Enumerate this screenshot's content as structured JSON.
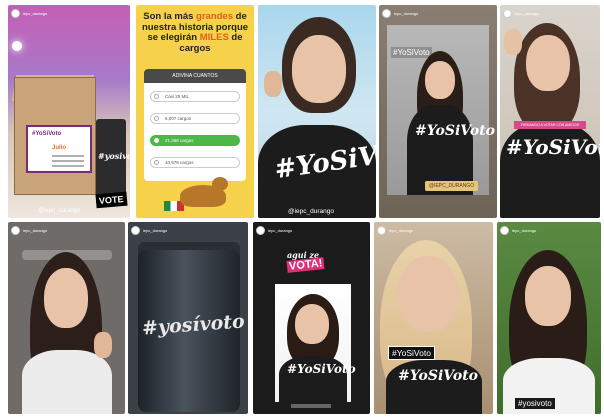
{
  "story1": {
    "username": "iepc_durango",
    "card_title": "#YoSiVoto",
    "card_name": "Julio",
    "tumbler_text": "#yosivoto",
    "vote_sticker": "VOTE",
    "bottom_tag": "@iepc_durango"
  },
  "story2": {
    "title_part1": "Son la más ",
    "title_hl1": "grandes",
    "title_part2": " de nuestra historia porque se elegirán ",
    "title_hl2": "MILES",
    "title_part3": " de cargos",
    "quiz_header": "ADIVINA CUANTOS",
    "options": [
      "Casi 25 MIL",
      "6,007 cargos",
      "21,368 cargos",
      "10,578 cargos"
    ]
  },
  "story3": {
    "shirt_text": "#YoSiVoto",
    "bottom_tag": "@iepc_durango"
  },
  "story4": {
    "username": "iepc_durango",
    "hashtag": "#YoSiVoto",
    "shirt_text": "#YoSiVoto",
    "pill": "@IEPC_DURANGO"
  },
  "story5": {
    "username": "iepc_durango",
    "banner": "FIRMANDO A VOTAR CON AMIGOS",
    "shirt_text": "#YoSiVoto"
  },
  "story6": {
    "username": "iepc_durango"
  },
  "story7": {
    "username": "iepc_durango",
    "tumbler_text": "#yosívoto"
  },
  "story8": {
    "username": "iepc_durango",
    "sticker_top": "agui ze",
    "sticker_bottom": "VOTA!",
    "shirt_text": "#YoSiVoto"
  },
  "story9": {
    "username": "iepc_durango",
    "label": "#YoSiVoto",
    "shirt_text": "#YoSiVoto"
  },
  "story10": {
    "username": "iepc_durango",
    "label": "#yosivoto"
  },
  "colors": {
    "quiz_correct": "#4cb848",
    "accent_orange": "#e25c22",
    "banner_pink": "#d64a8a",
    "sticker_pink": "#e0307a"
  }
}
